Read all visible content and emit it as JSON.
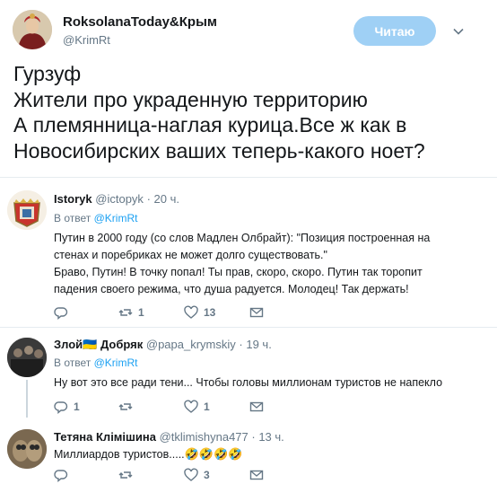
{
  "author": {
    "name": "RoksolanaToday&Крым",
    "handle": "@KrimRt",
    "follow_label": "Читаю"
  },
  "tweet": {
    "lines": [
      "Гурзуф",
      "Жители про украденную территорию",
      "А племянница-наглая курица.Все ж как в",
      "Новосибирских ваших теперь-какого ноет?"
    ]
  },
  "replies": [
    {
      "name": "Istoryk",
      "handle": "@ictopyk",
      "time": "· 20 ч.",
      "reply_prefix": "В ответ",
      "reply_to": "@KrimRt",
      "lines": [
        "Путин в 2000 году (со слов Мадлен Олбрайт): \"Позиция построенная на",
        "стенах и поребриках не может долго существовать.\"",
        "Браво, Путин! В точку попал! Ты прав, скоро, скоро. Путин так торопит",
        "падения своего режима, что душа радуется. Молодец! Так держать!"
      ],
      "counts": {
        "replies": "",
        "retweets": "1",
        "likes": "13"
      }
    },
    {
      "name": "Злой",
      "flag": "🇺🇦",
      "name2": "Добряк",
      "handle": "@papa_krymskiy",
      "time": "· 19 ч.",
      "reply_prefix": "В ответ",
      "reply_to": "@KrimRt",
      "lines": [
        "Ну вот это все ради тени... Чтобы головы миллионам туристов не напекло"
      ],
      "counts": {
        "replies": "1",
        "retweets": "",
        "likes": "1"
      }
    },
    {
      "name": "Тетяна Клімішина",
      "handle": "@tklimishyna477",
      "time": "· 13 ч.",
      "lines": [
        "Миллиардов туристов....."
      ],
      "emoji": "🤣🤣🤣🤣",
      "counts": {
        "replies": "",
        "retweets": "",
        "likes": "3"
      }
    }
  ],
  "colors": {
    "follow_button": "#9fd0f5",
    "link": "#1da1f2",
    "secondary_text": "#657786",
    "divider": "#e6ecf0"
  },
  "icons": [
    "caret-down-icon",
    "reply-icon",
    "retweet-icon",
    "like-icon",
    "dm-icon"
  ]
}
